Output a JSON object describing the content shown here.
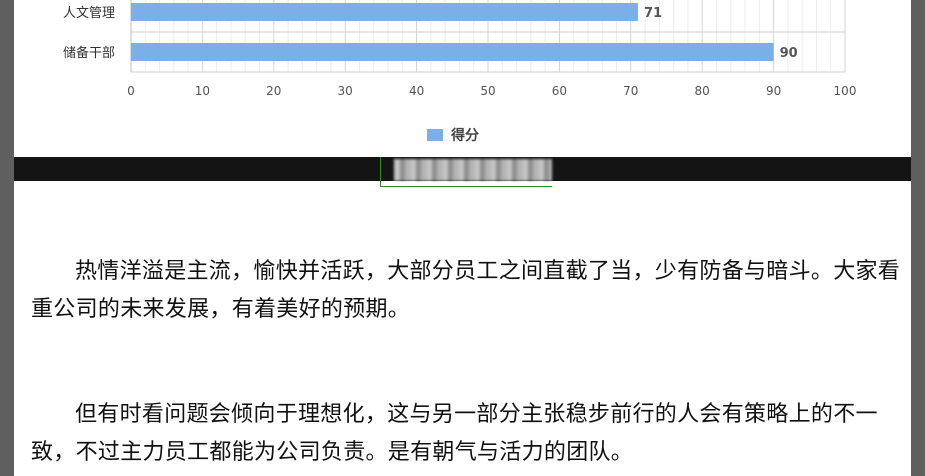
{
  "chart_data": {
    "type": "bar",
    "orientation": "horizontal",
    "categories": [
      "人文管理",
      "储备干部"
    ],
    "values": [
      71,
      90
    ],
    "xlim": [
      0,
      100
    ],
    "xticks": [
      0,
      10,
      20,
      30,
      40,
      50,
      60,
      70,
      80,
      90,
      100
    ],
    "series": [
      {
        "name": "得分",
        "values": [
          71,
          90
        ]
      }
    ],
    "legend": "bottom",
    "grid": true,
    "color": "#7aafe8"
  },
  "legend_label": "得分",
  "paragraphs": [
    "热情洋溢是主流，愉快并活跃，大部分员工之间直截了当，少有防备与暗斗。大家看重公司的未来发展，有着美好的预期。",
    "但有时看问题会倾向于理想化，这与另一部分主张稳步前行的人会有策略上的不一致，不过主力员工都能为公司负责。是有朝气与活力的团队。"
  ]
}
